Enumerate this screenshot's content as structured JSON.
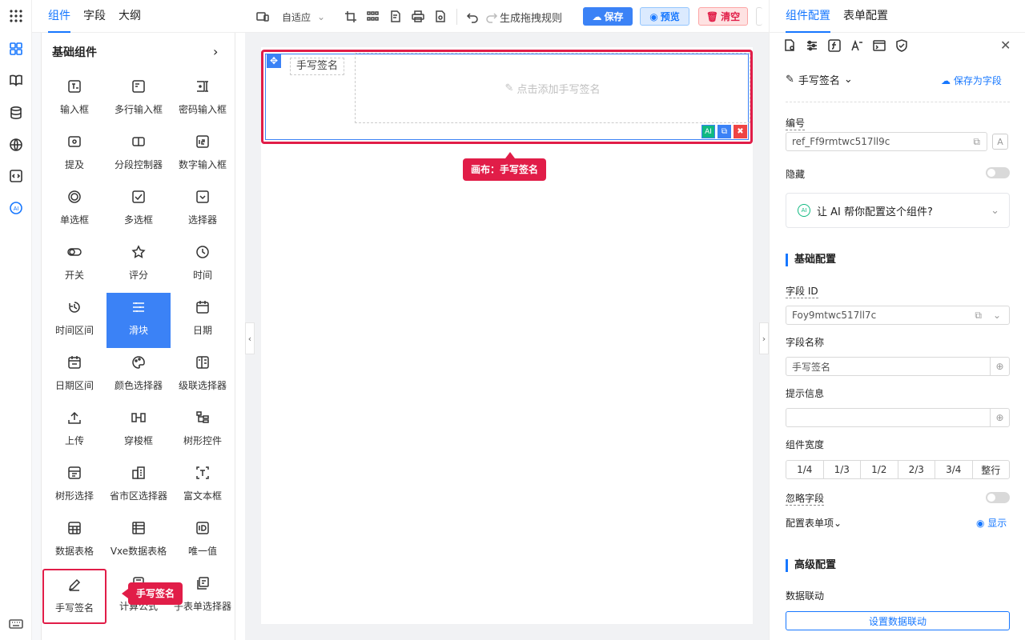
{
  "left_tabs": [
    "组件",
    "字段",
    "大纲"
  ],
  "left_section_title": "基础组件",
  "components": [
    {
      "label": "输入框",
      "icon": "input-icon"
    },
    {
      "label": "多行输入框",
      "icon": "textarea-icon"
    },
    {
      "label": "密码输入框",
      "icon": "password-icon"
    },
    {
      "label": "提及",
      "icon": "mention-icon"
    },
    {
      "label": "分段控制器",
      "icon": "segmented-icon"
    },
    {
      "label": "数字输入框",
      "icon": "number-icon"
    },
    {
      "label": "单选框",
      "icon": "radio-icon"
    },
    {
      "label": "多选框",
      "icon": "checkbox-icon"
    },
    {
      "label": "选择器",
      "icon": "select-icon"
    },
    {
      "label": "开关",
      "icon": "switch-icon"
    },
    {
      "label": "评分",
      "icon": "star-icon"
    },
    {
      "label": "时间",
      "icon": "clock-icon"
    },
    {
      "label": "时间区间",
      "icon": "time-range-icon"
    },
    {
      "label": "滑块",
      "icon": "slider-icon"
    },
    {
      "label": "日期",
      "icon": "calendar-icon"
    },
    {
      "label": "日期区间",
      "icon": "date-range-icon"
    },
    {
      "label": "颜色选择器",
      "icon": "palette-icon"
    },
    {
      "label": "级联选择器",
      "icon": "cascader-icon"
    },
    {
      "label": "上传",
      "icon": "upload-icon"
    },
    {
      "label": "穿梭框",
      "icon": "transfer-icon"
    },
    {
      "label": "树形控件",
      "icon": "tree-icon"
    },
    {
      "label": "树形选择",
      "icon": "tree-select-icon"
    },
    {
      "label": "省市区选择器",
      "icon": "region-icon"
    },
    {
      "label": "富文本框",
      "icon": "rich-text-icon"
    },
    {
      "label": "数据表格",
      "icon": "table-icon"
    },
    {
      "label": "Vxe数据表格",
      "icon": "vxe-table-icon"
    },
    {
      "label": "唯一值",
      "icon": "id-icon"
    },
    {
      "label": "手写签名",
      "icon": "pen-icon"
    },
    {
      "label": "计算公式",
      "icon": "calculator-icon"
    },
    {
      "label": "子表单选择器",
      "icon": "subform-icon"
    }
  ],
  "selected_component": "滑块",
  "highlight_tooltip": "手写签名",
  "toolbar": {
    "adaptive_label": "自适应",
    "generate_label": "生成拖拽规则",
    "save_label": "保存",
    "preview_label": "预览",
    "clear_label": "清空"
  },
  "canvas": {
    "field_label": "手写签名",
    "placeholder": "点击添加手写签名",
    "tooltip": "画布：手写签名"
  },
  "right_tabs": [
    "组件配置",
    "表单配置"
  ],
  "config": {
    "component_name": "手写签名",
    "save_as_field": "保存为字段",
    "id_label": "编号",
    "id_value": "ref_Ff9rmtwc517ll9c",
    "hidden_label": "隐藏",
    "ai_prompt": "让 AI 帮你配置这个组件?",
    "basic_section": "基础配置",
    "field_id_label": "字段 ID",
    "field_id_value": "Foy9mtwc517ll7c",
    "field_name_label": "字段名称",
    "field_name_value": "手写签名",
    "hint_label": "提示信息",
    "hint_value": "",
    "width_label": "组件宽度",
    "width_options": [
      "1/4",
      "1/3",
      "1/2",
      "2/3",
      "3/4",
      "整行"
    ],
    "ignore_label": "忽略字段",
    "form_items_label": "配置表单项",
    "show_label": "显示",
    "advanced_section": "高级配置",
    "linkage_label": "数据联动",
    "linkage_button": "设置数据联动"
  },
  "colors": {
    "accent": "#1677ff",
    "highlight": "#e11d48",
    "selected": "#3b82f6"
  }
}
